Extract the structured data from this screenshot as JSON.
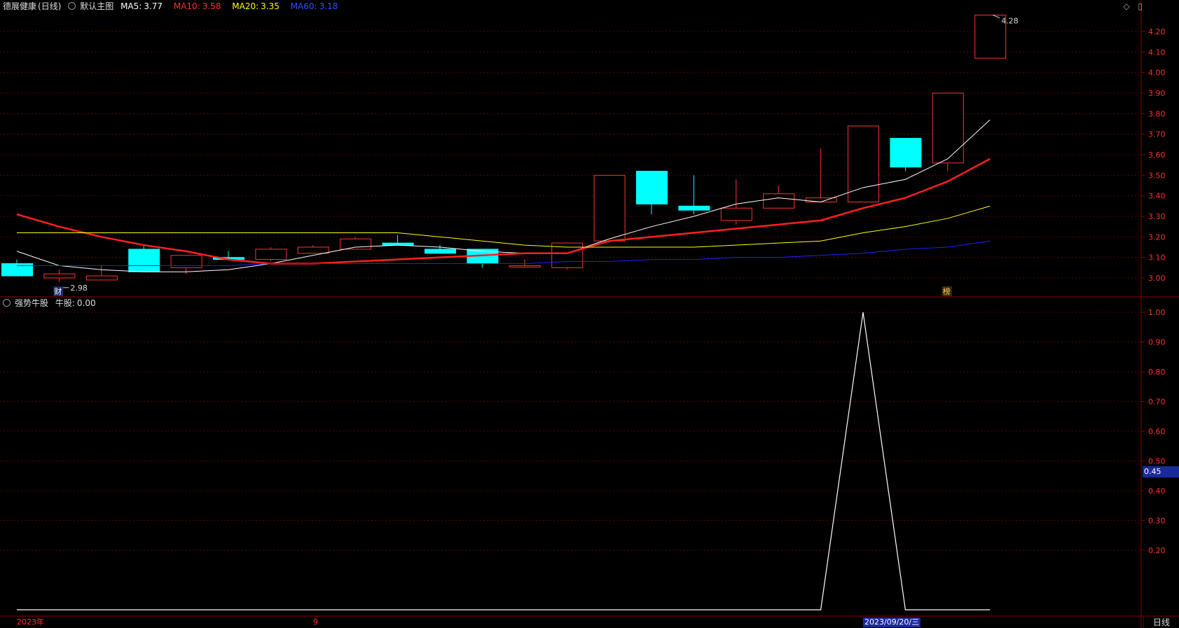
{
  "main_header": {
    "stock_name": "德展健康",
    "period_label": "(日线)",
    "template_label": "默认主图",
    "indicators": [
      {
        "label": "MA5:",
        "value": "3.77",
        "color": "#ffffff"
      },
      {
        "label": "MA10:",
        "value": "3.58",
        "color": "#ff3030"
      },
      {
        "label": "MA20:",
        "value": "3.35",
        "color": "#ffff00"
      },
      {
        "label": "MA60:",
        "value": "3.18",
        "color": "#2020ff"
      }
    ]
  },
  "sub_header": {
    "name": "强势牛股",
    "series_label": "牛股:",
    "value": "0.00"
  },
  "icons": [
    "diamond-icon",
    "window-icon"
  ],
  "period_button": "日线",
  "x_labels": {
    "year": "2023年",
    "month": "9",
    "cursor_date": "2023/09/20/三"
  },
  "cursor_value": "0.45",
  "colors": {
    "up": "#ff3333",
    "down": "#00ffff",
    "grid": "#5a0000",
    "border": "#8b0000",
    "axis_text": "#ff3030"
  },
  "chart_data": [
    {
      "type": "candlestick",
      "title": "德展健康 (日线)",
      "ylim": [
        2.95,
        4.28
      ],
      "y_ticks": [
        "3.00",
        "3.10",
        "3.20",
        "3.30",
        "3.40",
        "3.50",
        "3.60",
        "3.70",
        "3.80",
        "3.90",
        "4.00",
        "4.10",
        "4.20"
      ],
      "candles": [
        {
          "o": 3.07,
          "h": 3.09,
          "l": 3.01,
          "c": 3.01
        },
        {
          "o": 3.0,
          "h": 3.04,
          "l": 2.98,
          "c": 3.02
        },
        {
          "o": 2.99,
          "h": 3.06,
          "l": 2.99,
          "c": 3.01
        },
        {
          "o": 3.14,
          "h": 3.16,
          "l": 3.03,
          "c": 3.03
        },
        {
          "o": 3.05,
          "h": 3.11,
          "l": 3.02,
          "c": 3.11
        },
        {
          "o": 3.1,
          "h": 3.13,
          "l": 3.09,
          "c": 3.09
        },
        {
          "o": 3.09,
          "h": 3.15,
          "l": 3.08,
          "c": 3.14
        },
        {
          "o": 3.12,
          "h": 3.16,
          "l": 3.12,
          "c": 3.15
        },
        {
          "o": 3.14,
          "h": 3.2,
          "l": 3.14,
          "c": 3.19
        },
        {
          "o": 3.17,
          "h": 3.21,
          "l": 3.16,
          "c": 3.16
        },
        {
          "o": 3.14,
          "h": 3.16,
          "l": 3.12,
          "c": 3.12
        },
        {
          "o": 3.14,
          "h": 3.14,
          "l": 3.05,
          "c": 3.07
        },
        {
          "o": 3.06,
          "h": 3.09,
          "l": 3.05,
          "c": 3.06
        },
        {
          "o": 3.05,
          "h": 3.17,
          "l": 3.04,
          "c": 3.17
        },
        {
          "o": 3.18,
          "h": 3.5,
          "l": 3.17,
          "c": 3.5
        },
        {
          "o": 3.52,
          "h": 3.52,
          "l": 3.31,
          "c": 3.36
        },
        {
          "o": 3.35,
          "h": 3.5,
          "l": 3.31,
          "c": 3.33
        },
        {
          "o": 3.28,
          "h": 3.48,
          "l": 3.26,
          "c": 3.34
        },
        {
          "o": 3.34,
          "h": 3.45,
          "l": 3.34,
          "c": 3.41
        },
        {
          "o": 3.37,
          "h": 3.63,
          "l": 3.37,
          "c": 3.39
        },
        {
          "o": 3.37,
          "h": 3.74,
          "l": 3.37,
          "c": 3.74
        },
        {
          "o": 3.68,
          "h": 3.68,
          "l": 3.52,
          "c": 3.54
        },
        {
          "o": 3.56,
          "h": 3.9,
          "l": 3.52,
          "c": 3.9
        },
        {
          "o": 4.07,
          "h": 4.28,
          "l": 4.07,
          "c": 4.28
        }
      ],
      "series": [
        {
          "name": "MA5",
          "color": "#ffffff",
          "width": 1,
          "values": [
            3.13,
            3.06,
            3.04,
            3.03,
            3.03,
            3.04,
            3.07,
            3.11,
            3.15,
            3.16,
            3.15,
            3.13,
            3.12,
            3.12,
            3.19,
            3.25,
            3.3,
            3.36,
            3.39,
            3.37,
            3.44,
            3.48,
            3.58,
            3.77
          ]
        },
        {
          "name": "MA10",
          "color": "#ff2020",
          "width": 2.5,
          "values": [
            3.31,
            3.25,
            3.2,
            3.16,
            3.13,
            3.09,
            3.07,
            3.07,
            3.08,
            3.09,
            3.1,
            3.11,
            3.12,
            3.12,
            3.18,
            3.2,
            3.22,
            3.24,
            3.26,
            3.28,
            3.34,
            3.39,
            3.47,
            3.58
          ]
        },
        {
          "name": "MA20",
          "color": "#ffff00",
          "width": 1,
          "values": [
            3.22,
            3.22,
            3.22,
            3.22,
            3.22,
            3.22,
            3.22,
            3.22,
            3.22,
            3.22,
            3.2,
            3.18,
            3.16,
            3.15,
            3.15,
            3.15,
            3.15,
            3.16,
            3.17,
            3.18,
            3.22,
            3.25,
            3.29,
            3.35
          ]
        },
        {
          "name": "MA60",
          "color": "#2020ff",
          "width": 1,
          "values": [
            3.06,
            3.06,
            3.06,
            3.06,
            3.06,
            3.06,
            3.07,
            3.07,
            3.07,
            3.07,
            3.07,
            3.07,
            3.07,
            3.08,
            3.08,
            3.09,
            3.09,
            3.1,
            3.1,
            3.11,
            3.12,
            3.14,
            3.15,
            3.18
          ]
        }
      ],
      "annotations": [
        {
          "label": "2.98",
          "candle_index": 1,
          "value": 2.98
        },
        {
          "label": "4.28",
          "candle_index": 23,
          "value": 4.28
        },
        {
          "label": "财",
          "candle_index": 1
        },
        {
          "label": "榜",
          "candle_index": 22
        }
      ]
    },
    {
      "type": "line",
      "title": "强势牛股",
      "ylim": [
        0.1,
        1.02
      ],
      "y_ticks": [
        "0.20",
        "0.30",
        "0.40",
        "0.50",
        "0.60",
        "0.70",
        "0.80",
        "0.90",
        "1.00"
      ],
      "series": [
        {
          "name": "牛股",
          "color": "#ffffff",
          "values": [
            0,
            0,
            0,
            0,
            0,
            0,
            0,
            0,
            0,
            0,
            0,
            0,
            0,
            0,
            0,
            0,
            0,
            0,
            0,
            0,
            1,
            0,
            0,
            0
          ]
        }
      ]
    }
  ]
}
